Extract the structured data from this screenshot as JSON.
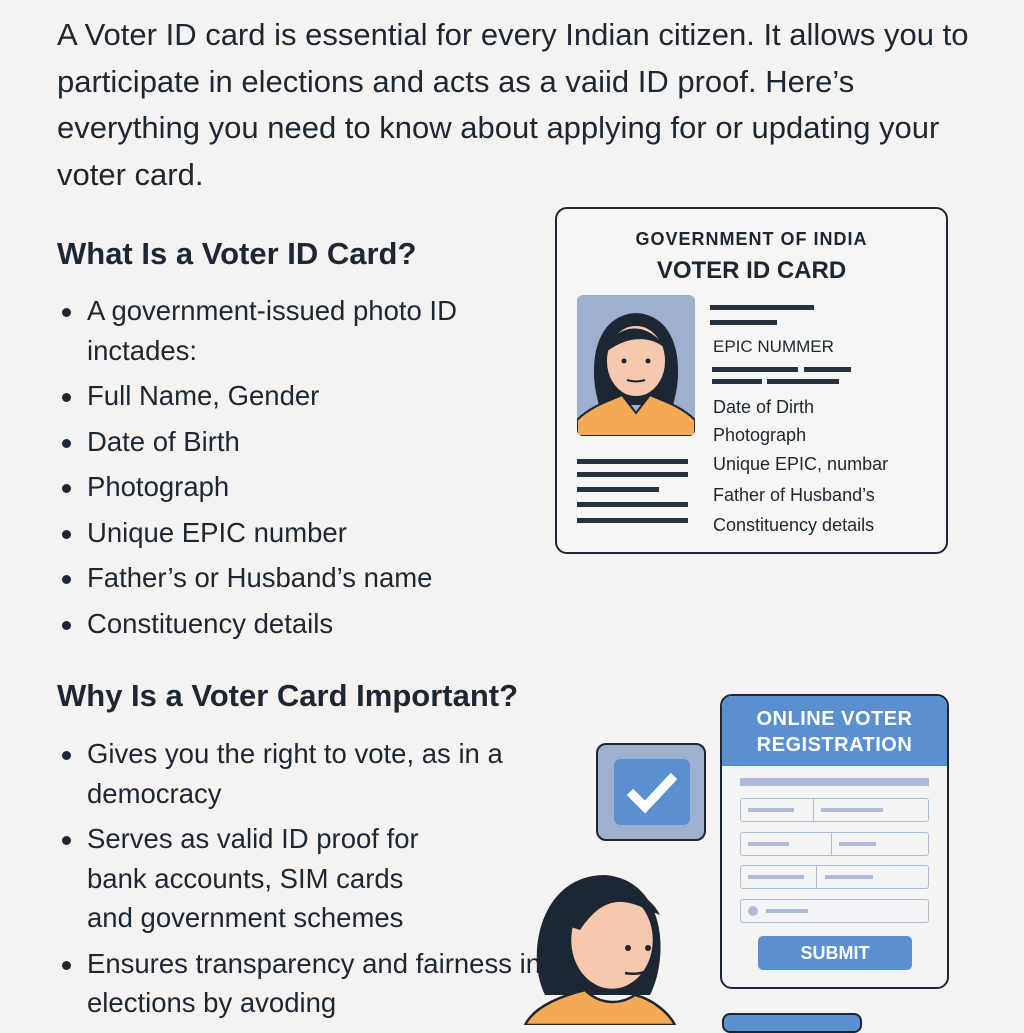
{
  "intro": "A Voter ID card is essential for every Indian citizen. It allows you to participate in elections and acts as a vaiid ID proof. Here’s everything you need to know about applying for or updating your voter card.",
  "section1": {
    "heading": "What Is a Voter ID Card?",
    "items": [
      "A government-issued photo ID inctades:",
      "Full Name, Gender",
      "Date of Birth",
      "Photograph",
      "Unique EPIC number",
      "Father’s or Husband’s name",
      "Constituency details"
    ]
  },
  "card": {
    "issuer": "GOVERNMENT OF INDIA",
    "title": "VOTER ID CARD",
    "epic_label": "EPIC NUMMER",
    "fields": [
      "Date of Dirth",
      "Photograph",
      "Unique EPIC, numbar",
      "Father of Husband’s",
      "Constituency details"
    ]
  },
  "section2": {
    "heading": "Why Is a Voter Card Important?",
    "items": [
      "Gives you the right to vote, as in a democracy",
      "Serves as valid ID proof for bank accounts, SIM cards and government schemes",
      "Ensures transparency and fairness in elections by avoding"
    ]
  },
  "form": {
    "title": "ONLINE VOTER REGISTRATION",
    "submit_label": "SUBMIT"
  },
  "colors": {
    "accent": "#5a8fd0",
    "text": "#1c2733",
    "skin": "#f6c8ad",
    "shirt": "#f5a955"
  }
}
